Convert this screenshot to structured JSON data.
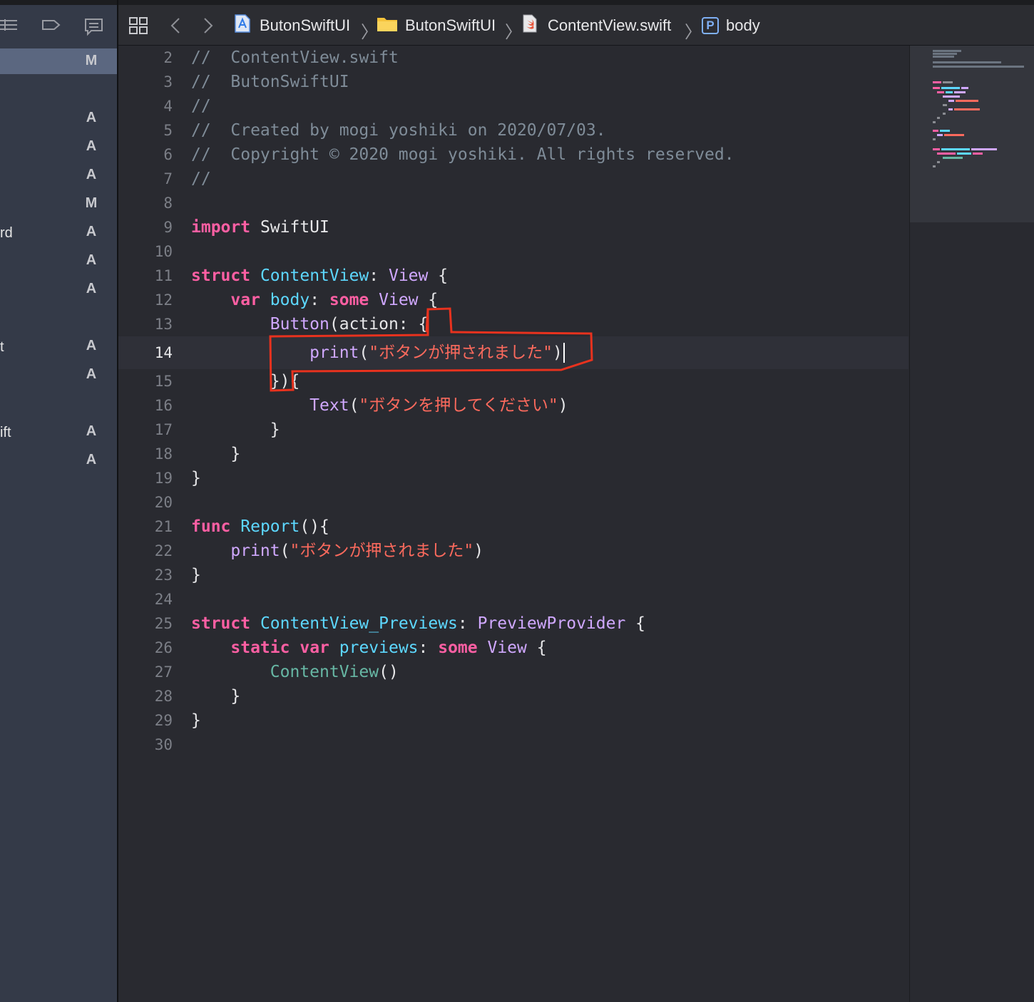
{
  "sidebar": {
    "rows": [
      {
        "name": "",
        "status": "M",
        "selected": true
      },
      {
        "name": "",
        "status": ""
      },
      {
        "name": "",
        "status": "A"
      },
      {
        "name": "",
        "status": "A"
      },
      {
        "name": "",
        "status": "A"
      },
      {
        "name": "",
        "status": "M"
      },
      {
        "name": "rd",
        "status": "A"
      },
      {
        "name": "",
        "status": "A"
      },
      {
        "name": "",
        "status": "A"
      },
      {
        "name": "",
        "status": ""
      },
      {
        "name": "t",
        "status": "A"
      },
      {
        "name": "",
        "status": "A"
      },
      {
        "name": "",
        "status": ""
      },
      {
        "name": "ift",
        "status": "A"
      },
      {
        "name": "",
        "status": "A"
      }
    ]
  },
  "jumpbar": {
    "project": "ButonSwiftUI",
    "folder": "ButonSwiftUI",
    "file": "ContentView.swift",
    "symbol_badge": "P",
    "symbol": "body"
  },
  "editor": {
    "current_line": 14,
    "lines": [
      {
        "n": "2",
        "tokens": [
          {
            "c": "cm",
            "t": "//  ContentView.swift"
          }
        ]
      },
      {
        "n": "3",
        "tokens": [
          {
            "c": "cm",
            "t": "//  ButonSwiftUI"
          }
        ]
      },
      {
        "n": "4",
        "tokens": [
          {
            "c": "cm",
            "t": "//"
          }
        ]
      },
      {
        "n": "5",
        "tokens": [
          {
            "c": "cm",
            "t": "//  Created by mogi yoshiki on 2020/07/03."
          }
        ]
      },
      {
        "n": "6",
        "tokens": [
          {
            "c": "cm",
            "t": "//  Copyright © 2020 mogi yoshiki. All rights reserved."
          }
        ]
      },
      {
        "n": "7",
        "tokens": [
          {
            "c": "cm",
            "t": "//"
          }
        ]
      },
      {
        "n": "8",
        "tokens": []
      },
      {
        "n": "9",
        "tokens": [
          {
            "c": "kw",
            "t": "import"
          },
          {
            "c": "",
            "t": " SwiftUI"
          }
        ]
      },
      {
        "n": "10",
        "tokens": []
      },
      {
        "n": "11",
        "tokens": [
          {
            "c": "kw",
            "t": "struct"
          },
          {
            "c": "",
            "t": " "
          },
          {
            "c": "ty",
            "t": "ContentView"
          },
          {
            "c": "",
            "t": ": "
          },
          {
            "c": "sy",
            "t": "View"
          },
          {
            "c": "",
            "t": " {"
          }
        ]
      },
      {
        "n": "12",
        "tokens": [
          {
            "c": "",
            "t": "    "
          },
          {
            "c": "kw",
            "t": "var"
          },
          {
            "c": "",
            "t": " "
          },
          {
            "c": "ty",
            "t": "body"
          },
          {
            "c": "",
            "t": ": "
          },
          {
            "c": "kw",
            "t": "some"
          },
          {
            "c": "",
            "t": " "
          },
          {
            "c": "sy",
            "t": "View"
          },
          {
            "c": "",
            "t": " {"
          }
        ]
      },
      {
        "n": "13",
        "tokens": [
          {
            "c": "",
            "t": "        "
          },
          {
            "c": "sy",
            "t": "Button"
          },
          {
            "c": "",
            "t": "(action: {"
          }
        ]
      },
      {
        "n": "14",
        "tokens": [
          {
            "c": "",
            "t": "            "
          },
          {
            "c": "sy",
            "t": "print"
          },
          {
            "c": "",
            "t": "("
          },
          {
            "c": "st",
            "t": "\"ボタンが押されました\""
          },
          {
            "c": "",
            "t": ")"
          }
        ]
      },
      {
        "n": "15",
        "tokens": [
          {
            "c": "",
            "t": "        }){"
          }
        ]
      },
      {
        "n": "16",
        "tokens": [
          {
            "c": "",
            "t": "            "
          },
          {
            "c": "sy",
            "t": "Text"
          },
          {
            "c": "",
            "t": "("
          },
          {
            "c": "st",
            "t": "\"ボタンを押してください\""
          },
          {
            "c": "",
            "t": ")"
          }
        ]
      },
      {
        "n": "17",
        "tokens": [
          {
            "c": "",
            "t": "        }"
          }
        ]
      },
      {
        "n": "18",
        "tokens": [
          {
            "c": "",
            "t": "    }"
          }
        ]
      },
      {
        "n": "19",
        "tokens": [
          {
            "c": "",
            "t": "}"
          }
        ]
      },
      {
        "n": "20",
        "tokens": []
      },
      {
        "n": "21",
        "tokens": [
          {
            "c": "kw",
            "t": "func"
          },
          {
            "c": "",
            "t": " "
          },
          {
            "c": "ty",
            "t": "Report"
          },
          {
            "c": "",
            "t": "(){"
          }
        ]
      },
      {
        "n": "22",
        "tokens": [
          {
            "c": "",
            "t": "    "
          },
          {
            "c": "sy",
            "t": "print"
          },
          {
            "c": "",
            "t": "("
          },
          {
            "c": "st",
            "t": "\"ボタンが押されました\""
          },
          {
            "c": "",
            "t": ")"
          }
        ]
      },
      {
        "n": "23",
        "tokens": [
          {
            "c": "",
            "t": "}"
          }
        ]
      },
      {
        "n": "24",
        "tokens": []
      },
      {
        "n": "25",
        "tokens": [
          {
            "c": "kw",
            "t": "struct"
          },
          {
            "c": "",
            "t": " "
          },
          {
            "c": "ty",
            "t": "ContentView_Previews"
          },
          {
            "c": "",
            "t": ": "
          },
          {
            "c": "sy",
            "t": "PreviewProvider"
          },
          {
            "c": "",
            "t": " {"
          }
        ]
      },
      {
        "n": "26",
        "tokens": [
          {
            "c": "",
            "t": "    "
          },
          {
            "c": "kw",
            "t": "static"
          },
          {
            "c": "",
            "t": " "
          },
          {
            "c": "kw",
            "t": "var"
          },
          {
            "c": "",
            "t": " "
          },
          {
            "c": "ty",
            "t": "previews"
          },
          {
            "c": "",
            "t": ": "
          },
          {
            "c": "kw",
            "t": "some"
          },
          {
            "c": "",
            "t": " "
          },
          {
            "c": "sy",
            "t": "View"
          },
          {
            "c": "",
            "t": " {"
          }
        ]
      },
      {
        "n": "27",
        "tokens": [
          {
            "c": "",
            "t": "        "
          },
          {
            "c": "pp",
            "t": "ContentView"
          },
          {
            "c": "",
            "t": "()"
          }
        ]
      },
      {
        "n": "28",
        "tokens": [
          {
            "c": "",
            "t": "    }"
          }
        ]
      },
      {
        "n": "29",
        "tokens": [
          {
            "c": "",
            "t": "}"
          }
        ]
      },
      {
        "n": "30",
        "tokens": []
      }
    ]
  },
  "colors": {
    "keyword": "#fc5fa3",
    "type_decl": "#5dd8ff",
    "system_symbol": "#d0a8ff",
    "project_symbol": "#67b7a4",
    "string": "#fc6a5d",
    "comment": "#7f8c98",
    "annotation": "#e8321e"
  }
}
